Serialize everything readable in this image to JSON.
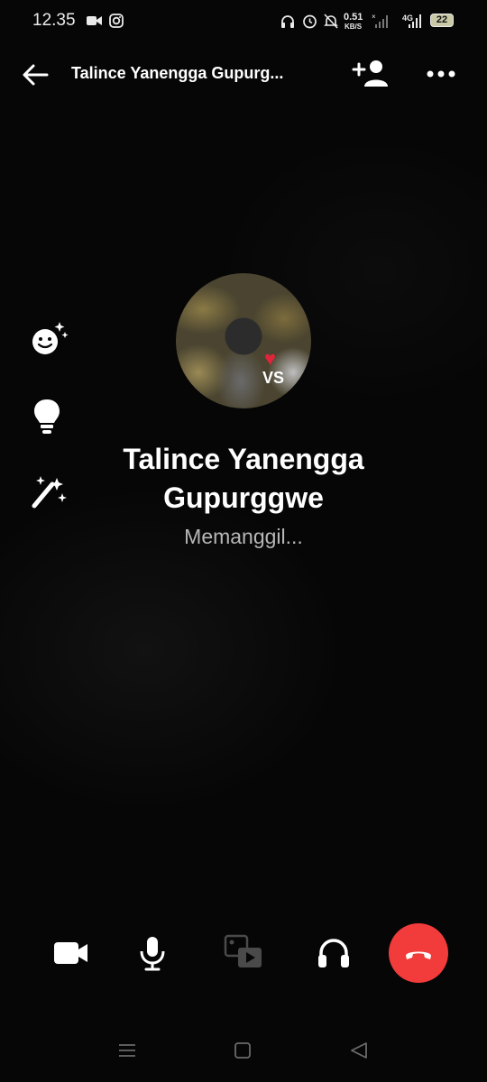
{
  "status_bar": {
    "time": "12.35",
    "network_speed_value": "0.51",
    "network_speed_unit": "KB/S",
    "network_type": "4G",
    "battery_level": "22",
    "icons": [
      "video-camera-icon",
      "instagram-icon",
      "headphones-icon",
      "alarm-icon",
      "mute-icon",
      "signal-icon",
      "battery-icon"
    ]
  },
  "header": {
    "title": "Talince Yanengga Gupurg...",
    "back_icon": "back-arrow-icon",
    "add_person_icon": "add-person-icon",
    "more_icon": "more-options-icon"
  },
  "side_tools": [
    "effects-icon",
    "lightbulb-icon",
    "magic-wand-icon"
  ],
  "avatar": {
    "overlay_text": "VS"
  },
  "caller": {
    "name_line1": "Talince Yanengga",
    "name_line2": "Gupurggwe",
    "status": "Memanggil..."
  },
  "controls": [
    "video-icon",
    "microphone-icon",
    "share-media-icon",
    "audio-output-icon",
    "end-call-icon"
  ],
  "colors": {
    "background": "#060606",
    "end_call": "#f23b3b",
    "status_text": "#b7b7b7"
  },
  "nav_bar": [
    "recent-apps-icon",
    "home-icon",
    "back-nav-icon"
  ]
}
